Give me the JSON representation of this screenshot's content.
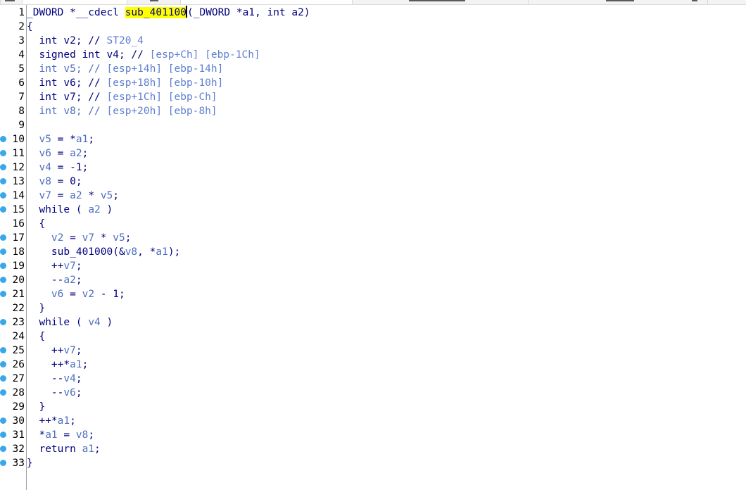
{
  "editor": {
    "lines": [
      {
        "n": "1",
        "bp": false,
        "segs": [
          {
            "t": "_DWORD *__cdecl ",
            "c": "kw"
          },
          {
            "t": "sub_40110",
            "c": "hl"
          },
          {
            "t": "0",
            "c": "hl-cursor"
          },
          {
            "t": "(_DWORD *a1, int a2)",
            "c": "kw"
          }
        ]
      },
      {
        "n": "2",
        "bp": false,
        "segs": [
          {
            "t": "{",
            "c": "kw"
          }
        ]
      },
      {
        "n": "3",
        "bp": false,
        "segs": [
          {
            "t": "  int v2; // ",
            "c": "kw"
          },
          {
            "t": "ST20_4",
            "c": "cmr"
          }
        ]
      },
      {
        "n": "4",
        "bp": false,
        "segs": [
          {
            "t": "  signed int v4; // ",
            "c": "kw"
          },
          {
            "t": "[esp+Ch] [ebp-1Ch]",
            "c": "cmr"
          }
        ]
      },
      {
        "n": "5",
        "bp": false,
        "segs": [
          {
            "t": "  int v5; // ",
            "c": "var"
          },
          {
            "t": "[esp+14h] [ebp-14h]",
            "c": "cmr"
          }
        ]
      },
      {
        "n": "6",
        "bp": false,
        "segs": [
          {
            "t": "  int v6; // ",
            "c": "kw"
          },
          {
            "t": "[esp+18h] [ebp-10h]",
            "c": "cmr"
          }
        ]
      },
      {
        "n": "7",
        "bp": false,
        "segs": [
          {
            "t": "  int v7; // ",
            "c": "kw"
          },
          {
            "t": "[esp+1Ch] [ebp-Ch]",
            "c": "cmr"
          }
        ]
      },
      {
        "n": "8",
        "bp": false,
        "segs": [
          {
            "t": "  int v8; // ",
            "c": "var"
          },
          {
            "t": "[esp+20h] [ebp-8h]",
            "c": "cmr"
          }
        ]
      },
      {
        "n": "9",
        "bp": false,
        "segs": []
      },
      {
        "n": "10",
        "bp": true,
        "segs": [
          {
            "t": "  ",
            "c": "kw"
          },
          {
            "t": "v5",
            "c": "var"
          },
          {
            "t": " = *",
            "c": "kw"
          },
          {
            "t": "a1",
            "c": "var"
          },
          {
            "t": ";",
            "c": "kw"
          }
        ]
      },
      {
        "n": "11",
        "bp": true,
        "segs": [
          {
            "t": "  ",
            "c": "kw"
          },
          {
            "t": "v6",
            "c": "var"
          },
          {
            "t": " = ",
            "c": "kw"
          },
          {
            "t": "a2",
            "c": "var"
          },
          {
            "t": ";",
            "c": "kw"
          }
        ]
      },
      {
        "n": "12",
        "bp": true,
        "segs": [
          {
            "t": "  ",
            "c": "kw"
          },
          {
            "t": "v4",
            "c": "var"
          },
          {
            "t": " = -1;",
            "c": "kw"
          }
        ]
      },
      {
        "n": "13",
        "bp": true,
        "segs": [
          {
            "t": "  ",
            "c": "kw"
          },
          {
            "t": "v8",
            "c": "var"
          },
          {
            "t": " = 0;",
            "c": "kw"
          }
        ]
      },
      {
        "n": "14",
        "bp": true,
        "segs": [
          {
            "t": "  ",
            "c": "kw"
          },
          {
            "t": "v7",
            "c": "var"
          },
          {
            "t": " = ",
            "c": "kw"
          },
          {
            "t": "a2",
            "c": "var"
          },
          {
            "t": " * ",
            "c": "kw"
          },
          {
            "t": "v5",
            "c": "var"
          },
          {
            "t": ";",
            "c": "kw"
          }
        ]
      },
      {
        "n": "15",
        "bp": true,
        "segs": [
          {
            "t": "  while ( ",
            "c": "kw"
          },
          {
            "t": "a2",
            "c": "var"
          },
          {
            "t": " )",
            "c": "kw"
          }
        ]
      },
      {
        "n": "16",
        "bp": false,
        "segs": [
          {
            "t": "  {",
            "c": "kw"
          }
        ]
      },
      {
        "n": "17",
        "bp": true,
        "segs": [
          {
            "t": "    ",
            "c": "kw"
          },
          {
            "t": "v2",
            "c": "var"
          },
          {
            "t": " = ",
            "c": "kw"
          },
          {
            "t": "v7",
            "c": "var"
          },
          {
            "t": " * ",
            "c": "kw"
          },
          {
            "t": "v5",
            "c": "var"
          },
          {
            "t": ";",
            "c": "kw"
          }
        ]
      },
      {
        "n": "18",
        "bp": true,
        "segs": [
          {
            "t": "    sub_401000(&",
            "c": "kw"
          },
          {
            "t": "v8",
            "c": "var"
          },
          {
            "t": ", *",
            "c": "kw"
          },
          {
            "t": "a1",
            "c": "var"
          },
          {
            "t": ");",
            "c": "kw"
          }
        ]
      },
      {
        "n": "19",
        "bp": true,
        "segs": [
          {
            "t": "    ++",
            "c": "kw"
          },
          {
            "t": "v7",
            "c": "var"
          },
          {
            "t": ";",
            "c": "kw"
          }
        ]
      },
      {
        "n": "20",
        "bp": true,
        "segs": [
          {
            "t": "    --",
            "c": "kw"
          },
          {
            "t": "a2",
            "c": "var"
          },
          {
            "t": ";",
            "c": "kw"
          }
        ]
      },
      {
        "n": "21",
        "bp": true,
        "segs": [
          {
            "t": "    ",
            "c": "kw"
          },
          {
            "t": "v6",
            "c": "var"
          },
          {
            "t": " = ",
            "c": "kw"
          },
          {
            "t": "v2",
            "c": "var"
          },
          {
            "t": " - 1;",
            "c": "kw"
          }
        ]
      },
      {
        "n": "22",
        "bp": false,
        "segs": [
          {
            "t": "  }",
            "c": "kw"
          }
        ]
      },
      {
        "n": "23",
        "bp": true,
        "segs": [
          {
            "t": "  while ( ",
            "c": "kw"
          },
          {
            "t": "v4",
            "c": "var"
          },
          {
            "t": " )",
            "c": "kw"
          }
        ]
      },
      {
        "n": "24",
        "bp": false,
        "segs": [
          {
            "t": "  {",
            "c": "kw"
          }
        ]
      },
      {
        "n": "25",
        "bp": true,
        "segs": [
          {
            "t": "    ++",
            "c": "kw"
          },
          {
            "t": "v7",
            "c": "var"
          },
          {
            "t": ";",
            "c": "kw"
          }
        ]
      },
      {
        "n": "26",
        "bp": true,
        "segs": [
          {
            "t": "    ++*",
            "c": "kw"
          },
          {
            "t": "a1",
            "c": "var"
          },
          {
            "t": ";",
            "c": "kw"
          }
        ]
      },
      {
        "n": "27",
        "bp": true,
        "segs": [
          {
            "t": "    --",
            "c": "kw"
          },
          {
            "t": "v4",
            "c": "var"
          },
          {
            "t": ";",
            "c": "kw"
          }
        ]
      },
      {
        "n": "28",
        "bp": true,
        "segs": [
          {
            "t": "    --",
            "c": "kw"
          },
          {
            "t": "v6",
            "c": "var"
          },
          {
            "t": ";",
            "c": "kw"
          }
        ]
      },
      {
        "n": "29",
        "bp": false,
        "segs": [
          {
            "t": "  }",
            "c": "kw"
          }
        ]
      },
      {
        "n": "30",
        "bp": true,
        "segs": [
          {
            "t": "  ++*",
            "c": "kw"
          },
          {
            "t": "a1",
            "c": "var"
          },
          {
            "t": ";",
            "c": "kw"
          }
        ]
      },
      {
        "n": "31",
        "bp": true,
        "segs": [
          {
            "t": "  *",
            "c": "kw"
          },
          {
            "t": "a1",
            "c": "var"
          },
          {
            "t": " = ",
            "c": "kw"
          },
          {
            "t": "v8",
            "c": "var"
          },
          {
            "t": ";",
            "c": "kw"
          }
        ]
      },
      {
        "n": "32",
        "bp": true,
        "segs": [
          {
            "t": "  return ",
            "c": "kw"
          },
          {
            "t": "a1",
            "c": "var"
          },
          {
            "t": ";",
            "c": "kw"
          }
        ]
      },
      {
        "n": "33",
        "bp": true,
        "segs": [
          {
            "t": "}",
            "c": "kw"
          }
        ]
      }
    ]
  },
  "colors": {
    "keyword": "#000080",
    "variable": "#4e6fc0",
    "comment_ref": "#5f7fcf",
    "highlight": "#ffff00",
    "breakpoint": "#3aa7e8"
  },
  "icons": {
    "breakpoint": "breakpoint-dot-icon"
  }
}
